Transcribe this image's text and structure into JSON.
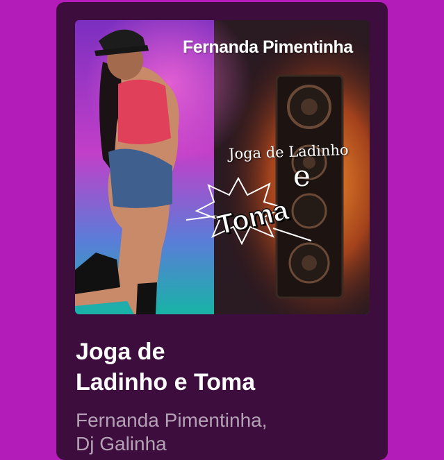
{
  "card": {
    "cover": {
      "artist_text": "Fernanda Pimentinha",
      "song_text": "Joga de Ladinho",
      "e_text": "e",
      "toma_text": "Toma"
    },
    "title_line1": "Joga de",
    "title_line2": "Ladinho e Toma",
    "artists_line1": "Fernanda Pimentinha,",
    "artists_line2": "Dj Galinha"
  },
  "colors": {
    "page_background": "#b41cba",
    "card_background": "#3c0d3d",
    "title_text": "#ffffff",
    "subtitle_text": "#b4a1b5"
  }
}
